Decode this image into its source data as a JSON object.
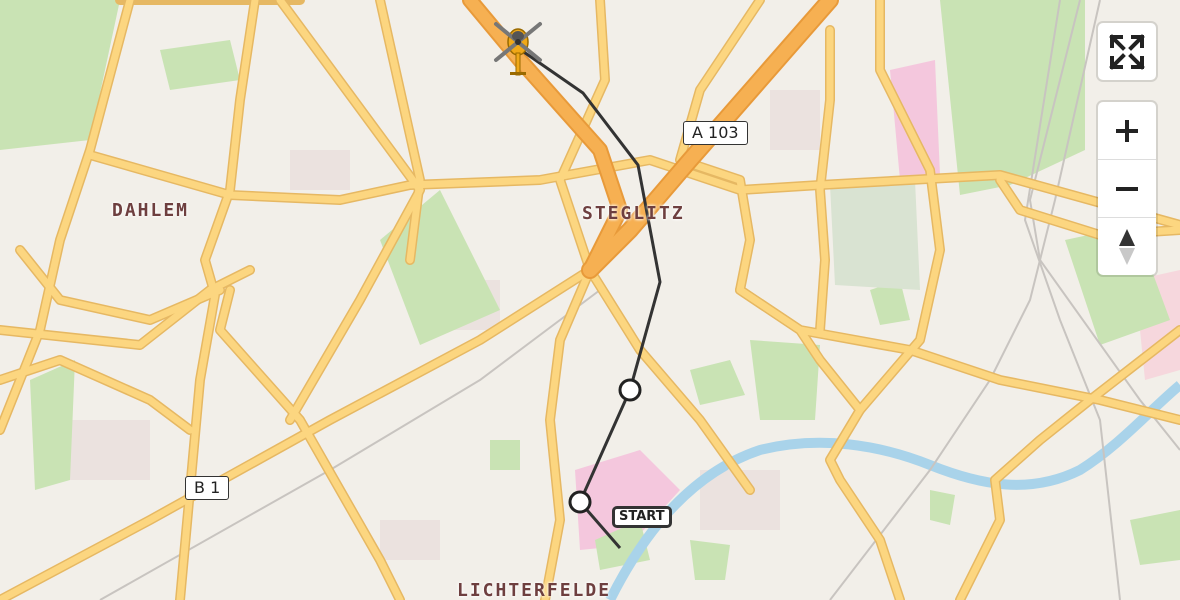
{
  "map": {
    "districts": [
      {
        "name": "DAHLEM"
      },
      {
        "name": "STEGLITZ"
      },
      {
        "name": "LICHTERFELDE"
      }
    ],
    "road_shields": [
      {
        "label": "A 103"
      },
      {
        "label": "B 1"
      }
    ],
    "start_label": "START",
    "colors": {
      "background": "#f2efe9",
      "road_major": "#fcd680",
      "road_casing": "#e6b863",
      "motorway": "#f6b052",
      "park": "#c9e3b4",
      "water": "#a9d3ea",
      "route": "#333333",
      "helicopter": "#f0a818"
    }
  },
  "controls": {
    "fullscreen_icon": "expand-arrows-icon",
    "zoom_in_icon": "plus-icon",
    "zoom_out_icon": "minus-icon",
    "compass_icon": "north-arrow-icon"
  }
}
